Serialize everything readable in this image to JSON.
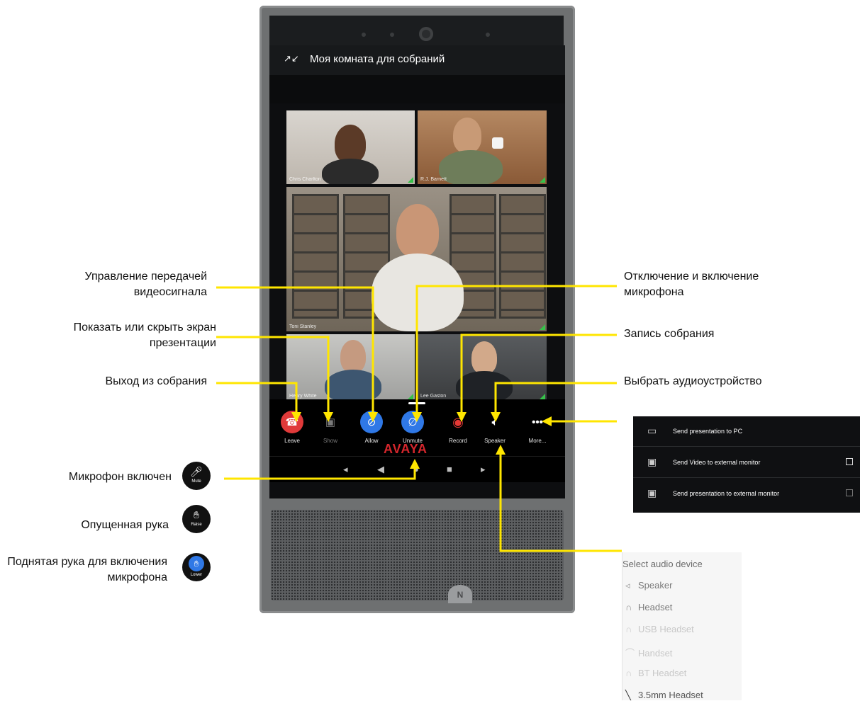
{
  "device": {
    "title": "Моя комната для собраний",
    "collapse_icon": "collapse-icon",
    "brand": "AVAYA",
    "participants": [
      "Chris Charlton",
      "R.J. Barnett",
      "Toni Stanley",
      "Henry White",
      "Lee Gaston"
    ],
    "toolbar": {
      "leave": "Leave",
      "show": "Show",
      "allow": "Allow",
      "unmute": "Unmute",
      "record": "Record",
      "speaker": "Speaker",
      "more": "More..."
    },
    "colors": {
      "leave": "#e03a3a",
      "active_blue": "#2f78e6",
      "record": "#e53935"
    }
  },
  "callouts": {
    "video_control": "Управление передачей видеосигнала",
    "show_hide": "Показать или скрыть экран презентации",
    "leave_meeting": "Выход из собрания",
    "mic_toggle": "Отключение и включение микрофона",
    "record_meeting": "Запись собрания",
    "select_audio": "Выбрать аудиоустройство",
    "mic_on": "Микрофон включен",
    "hand_lowered": "Опущенная рука",
    "hand_raised": "Поднятая рука для включения микрофона"
  },
  "state_icons": {
    "mute": "Mute",
    "raise": "Raise",
    "lower": "Lower"
  },
  "more_panel": {
    "items": [
      {
        "label": "Send presentation to PC",
        "checkbox": false
      },
      {
        "label": "Send Video to external monitor",
        "checkbox": true
      },
      {
        "label": "Send presentation to external monitor",
        "checkbox": true
      }
    ]
  },
  "audio_panel": {
    "title": "Select audio device",
    "items": [
      {
        "label": "Speaker",
        "state": "normal"
      },
      {
        "label": "Headset",
        "state": "normal"
      },
      {
        "label": "USB Headset",
        "state": "disabled"
      },
      {
        "label": "Handset",
        "state": "disabled"
      },
      {
        "label": "BT Headset",
        "state": "disabled"
      },
      {
        "label": "3.5mm Headset",
        "state": "active"
      }
    ]
  }
}
